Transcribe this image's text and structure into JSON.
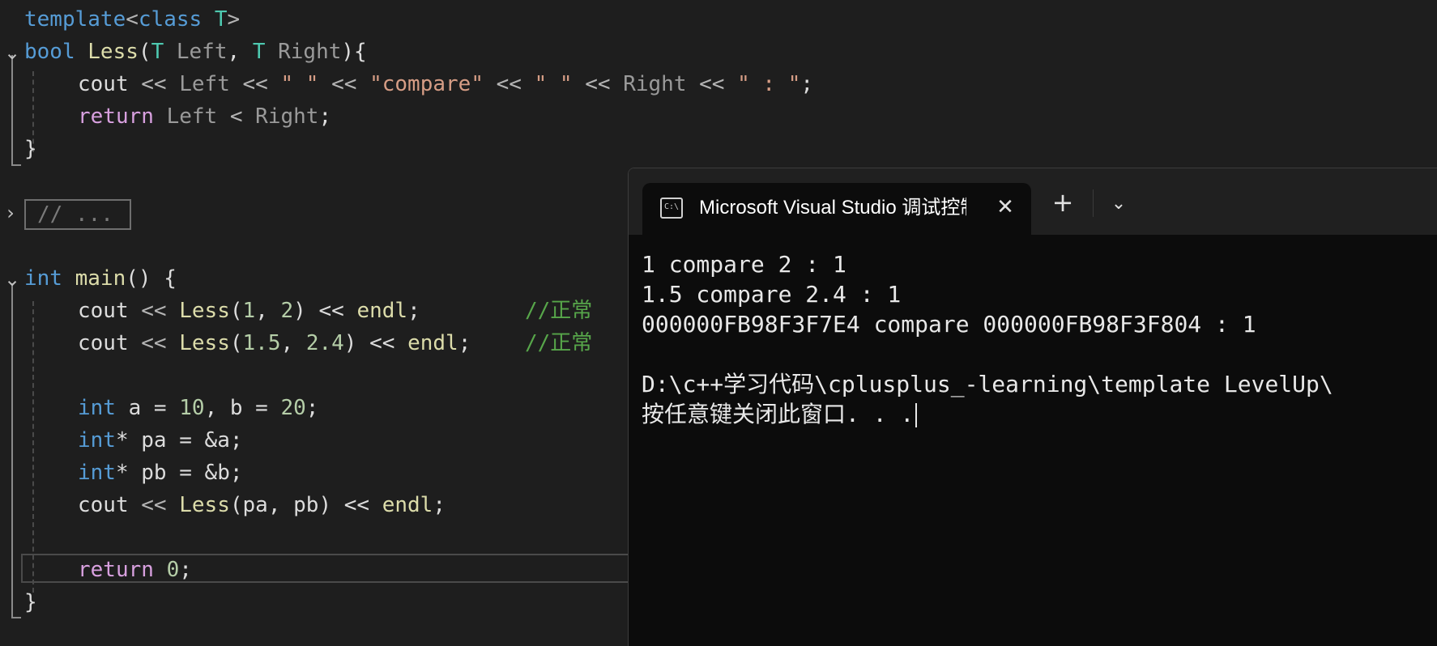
{
  "editor": {
    "lines": {
      "l1": [
        "template",
        "<",
        "class",
        " T",
        ">"
      ],
      "l2": [
        "bool",
        " Less",
        "(",
        "T",
        " Left",
        ", ",
        "T",
        " Right",
        "){"
      ],
      "l3": [
        "cout",
        " << ",
        "Left",
        " << ",
        "\" \"",
        " << ",
        "\"compare\"",
        " << ",
        "\" \"",
        " << ",
        "Right",
        " << ",
        "\" : \"",
        ";"
      ],
      "l4": [
        "return",
        " Left",
        " < ",
        "Right",
        ";"
      ],
      "l5": [
        "}"
      ],
      "l7": [
        "int",
        " main",
        "() {"
      ],
      "l8": [
        "cout",
        " << ",
        "Less",
        "(",
        "1",
        ", ",
        "2",
        ") << ",
        "endl",
        ";",
        "//正常"
      ],
      "l9": [
        "cout",
        " << ",
        "Less",
        "(",
        "1.5",
        ", ",
        "2.4",
        ") << ",
        "endl",
        ";",
        "//正常"
      ],
      "l11": [
        "int",
        " a = ",
        "10",
        ", b = ",
        "20",
        ";"
      ],
      "l12": [
        "int",
        "* pa = &a;"
      ],
      "l13": [
        "int",
        "* pb = &b;"
      ],
      "l14": [
        "cout",
        " << ",
        "Less",
        "(pa, pb) << ",
        "endl",
        ";"
      ],
      "l16": [
        "return",
        " ",
        "0",
        ";"
      ],
      "l17": [
        "}"
      ]
    },
    "collapsed_text": "// ...",
    "fold_icons": {
      "template_fold": "chevron-down-icon",
      "collapsed_fold": "chevron-right-icon",
      "main_fold": "chevron-down-icon"
    }
  },
  "terminal": {
    "tab_title": "Microsoft Visual Studio 调试控制台",
    "tab_icon_text": "C:\\",
    "close_glyph": "✕",
    "new_tab_glyph": "+",
    "dropdown_glyph": "⌄",
    "output": [
      "1 compare 2 : 1",
      "1.5 compare 2.4 : 1",
      "000000FB98F3F7E4 compare 000000FB98F3F804 : 1",
      "",
      "D:\\c++学习代码\\cplusplus_-learning\\template LevelUp\\",
      "按任意键关闭此窗口. . ."
    ]
  },
  "colors": {
    "editor_bg": "#1e1e1e",
    "terminal_bg": "#0c0c0c",
    "keyword": "#569cd6",
    "type": "#4ec9b0",
    "function": "#dcdcaa",
    "string": "#d69d85",
    "comment": "#57a64a",
    "number": "#b5cea8",
    "control": "#d8a0df"
  }
}
